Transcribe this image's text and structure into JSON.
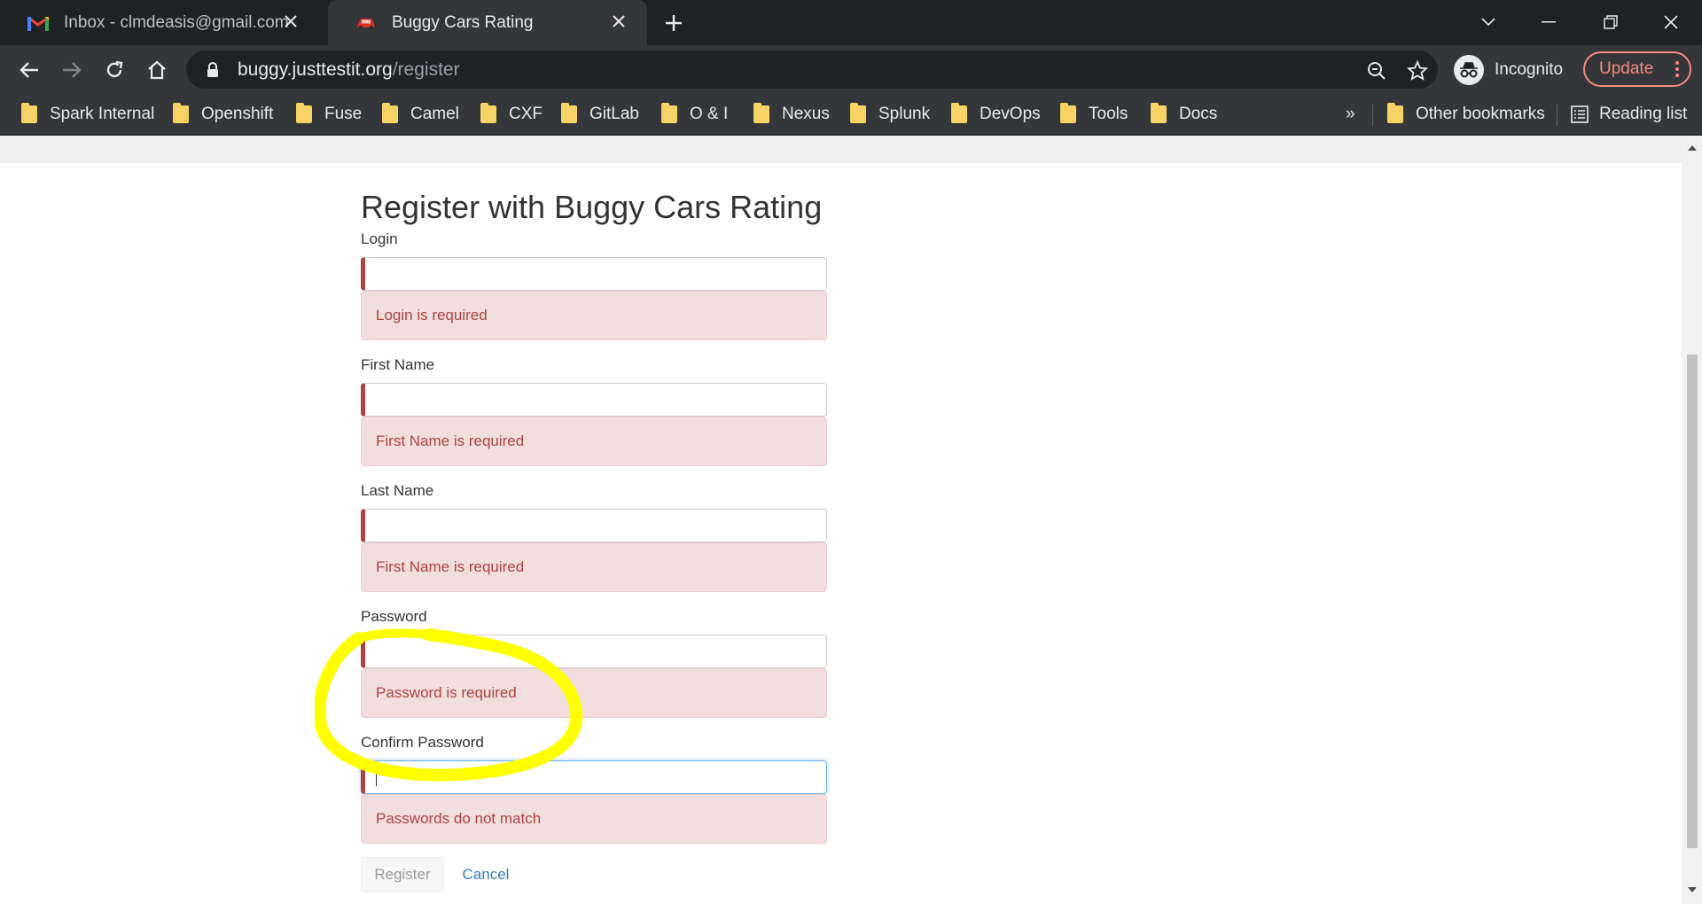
{
  "browser": {
    "tabs": [
      {
        "title": "Inbox - clmdeasis@gmail.com - Gmail",
        "favicon": "gmail-icon",
        "active": false
      },
      {
        "title": "Buggy Cars Rating",
        "favicon": "car-icon",
        "active": true
      }
    ],
    "url": {
      "host": "buggy.justtestit.org",
      "path": "/register"
    },
    "profile_label": "Incognito",
    "update_label": "Update",
    "bookmarks": [
      "Spark Internal",
      "Openshift",
      "Fuse",
      "Camel",
      "CXF",
      "GitLab",
      "O & I",
      "Nexus",
      "Splunk",
      "DevOps",
      "Tools",
      "Docs"
    ],
    "overflow_label": "»",
    "other_bookmarks": "Other bookmarks",
    "reading_list": "Reading list"
  },
  "form": {
    "title": "Register with Buggy Cars Rating",
    "fields": [
      {
        "label": "Login",
        "value": "",
        "error": "Login is required"
      },
      {
        "label": "First Name",
        "value": "",
        "error": "First Name is required"
      },
      {
        "label": "Last Name",
        "value": "",
        "error": "First Name is required"
      },
      {
        "label": "Password",
        "value": "",
        "error": "Password is required"
      },
      {
        "label": "Confirm Password",
        "value": "",
        "error": "Passwords do not match"
      }
    ],
    "register_label": "Register",
    "cancel_label": "Cancel"
  },
  "colors": {
    "error_text": "#a94442",
    "error_bg": "#f2dede",
    "link": "#337ab7",
    "highlight": "#ffff00"
  }
}
